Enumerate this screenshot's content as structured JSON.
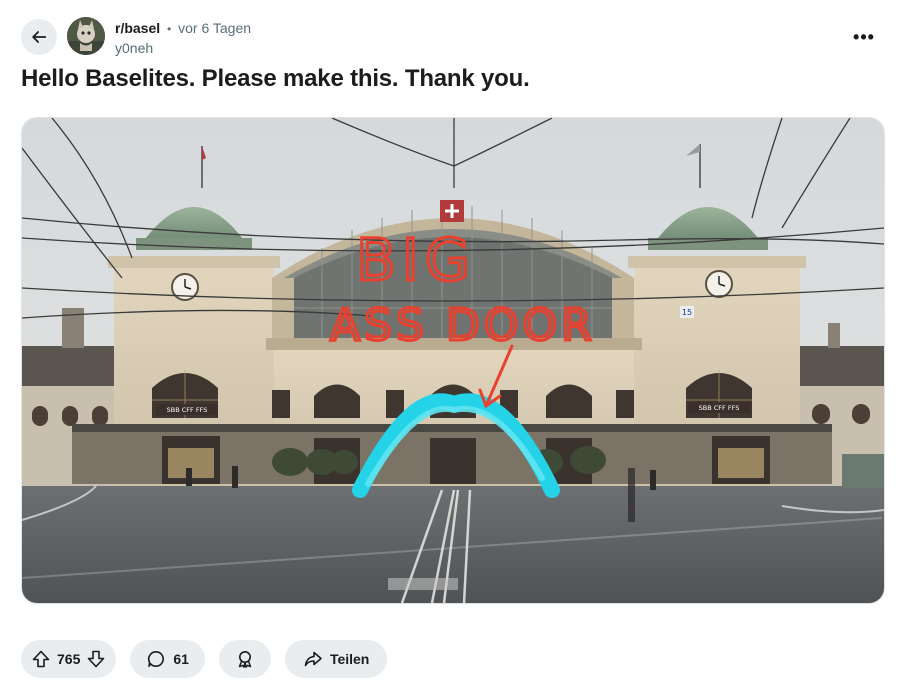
{
  "post": {
    "subreddit": "r/basel",
    "separator": "•",
    "time_ago": "vor 6 Tagen",
    "author": "y0neh",
    "title": "Hello Baselites. Please make this. Thank you.",
    "image": {
      "icon": "photo",
      "annotations": {
        "line1": "BIG",
        "line2": "ASS DOOR"
      },
      "sign_left": "SBB CFF FFS",
      "sign_right": "SBB CFF FFS",
      "platform_number": "15",
      "colors": {
        "sky": "#d9dde0",
        "building": "#d8ccb4",
        "dome": "#7f9a83",
        "annotation_red": "#e8412f",
        "arch_cyan": "#28d4e8",
        "pavement": "#5f6366"
      }
    }
  },
  "actions": {
    "upvote_icon": "upvote-arrow-icon",
    "score": "765",
    "downvote_icon": "downvote-arrow-icon",
    "comment_icon": "speech-bubble-icon",
    "comments": "61",
    "award_icon": "award-icon",
    "share_icon": "share-arrow-icon",
    "share_label": "Teilen"
  },
  "header": {
    "back_icon": "arrow-left-icon",
    "more_icon": "three-dots-icon",
    "more_glyph": "•••"
  },
  "theme": {
    "pill_bg": "#eaedef",
    "text_primary": "#1c1c1c",
    "text_secondary": "#576f76"
  }
}
